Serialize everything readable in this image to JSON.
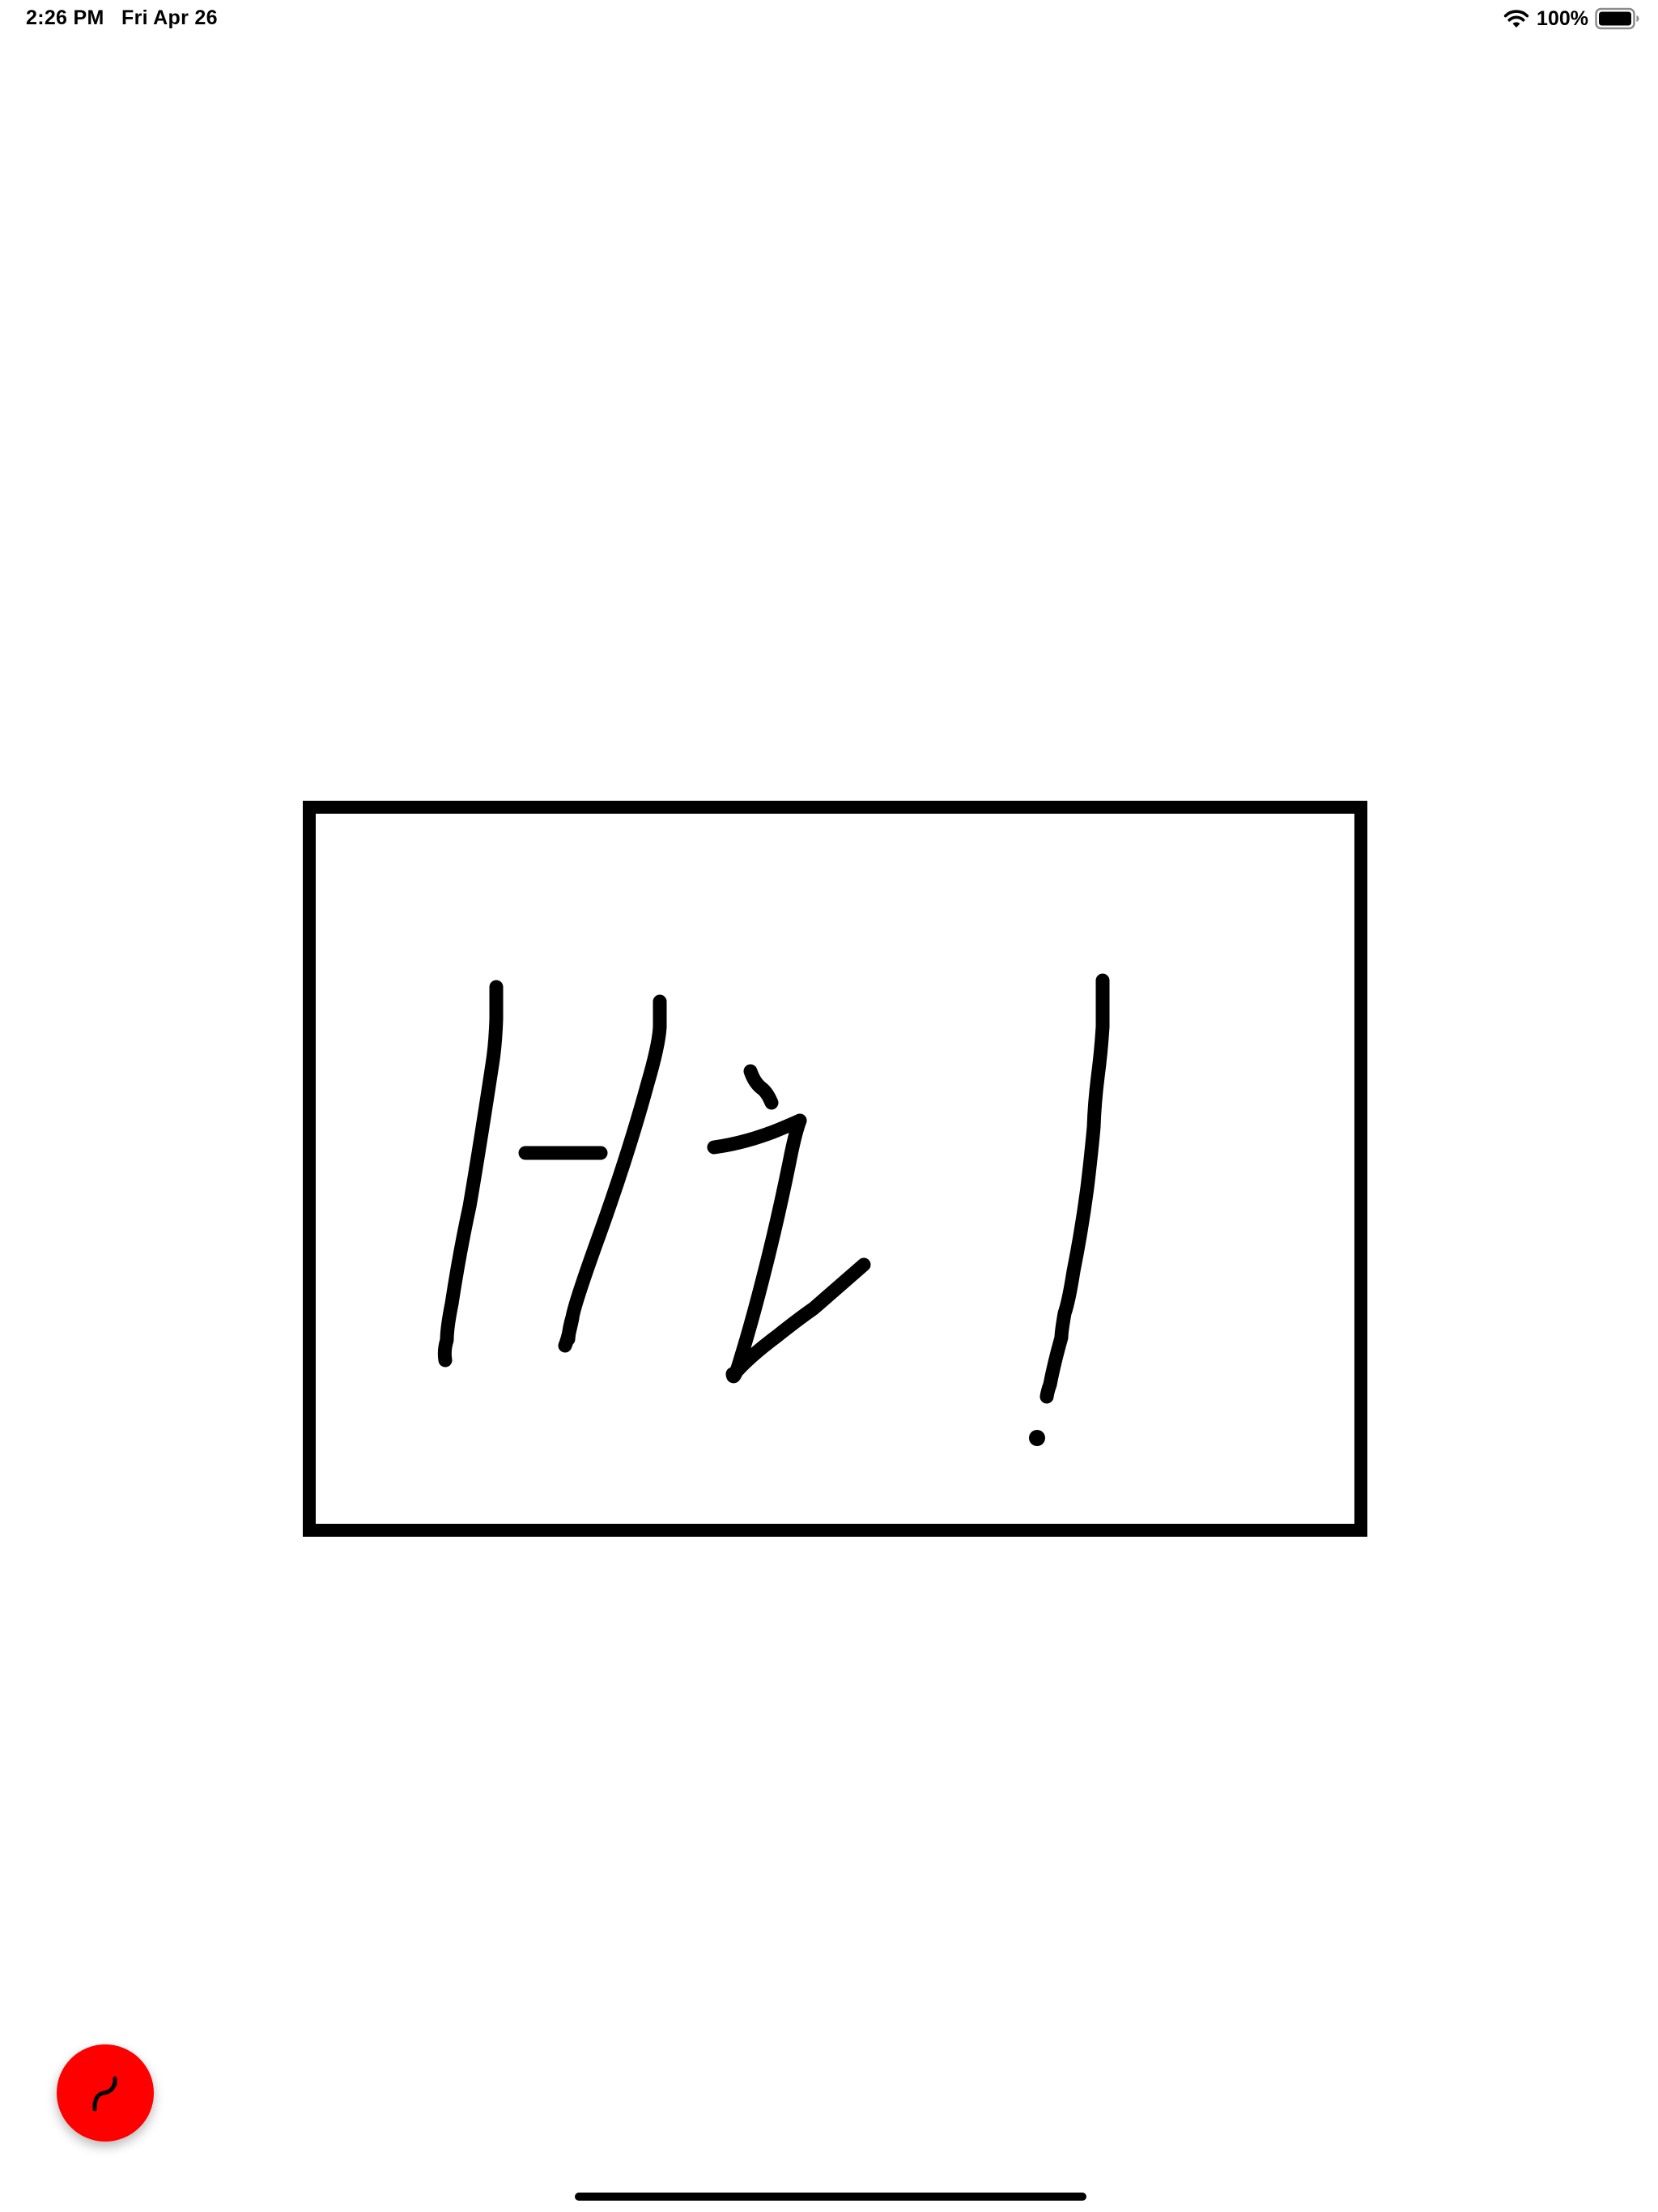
{
  "status_bar": {
    "time": "2:26 PM",
    "date": "Fri Apr 26",
    "battery_percent": "100%",
    "battery_level": 1.0,
    "wifi_icon": "wifi-icon",
    "battery_icon": "battery-icon"
  },
  "canvas": {
    "background_color": "#ffffff",
    "stroke_color": "#000000"
  },
  "tool_button": {
    "icon": "pen-stroke-icon",
    "background_color": "#ff0000"
  },
  "home_indicator": {
    "color": "#000000"
  }
}
